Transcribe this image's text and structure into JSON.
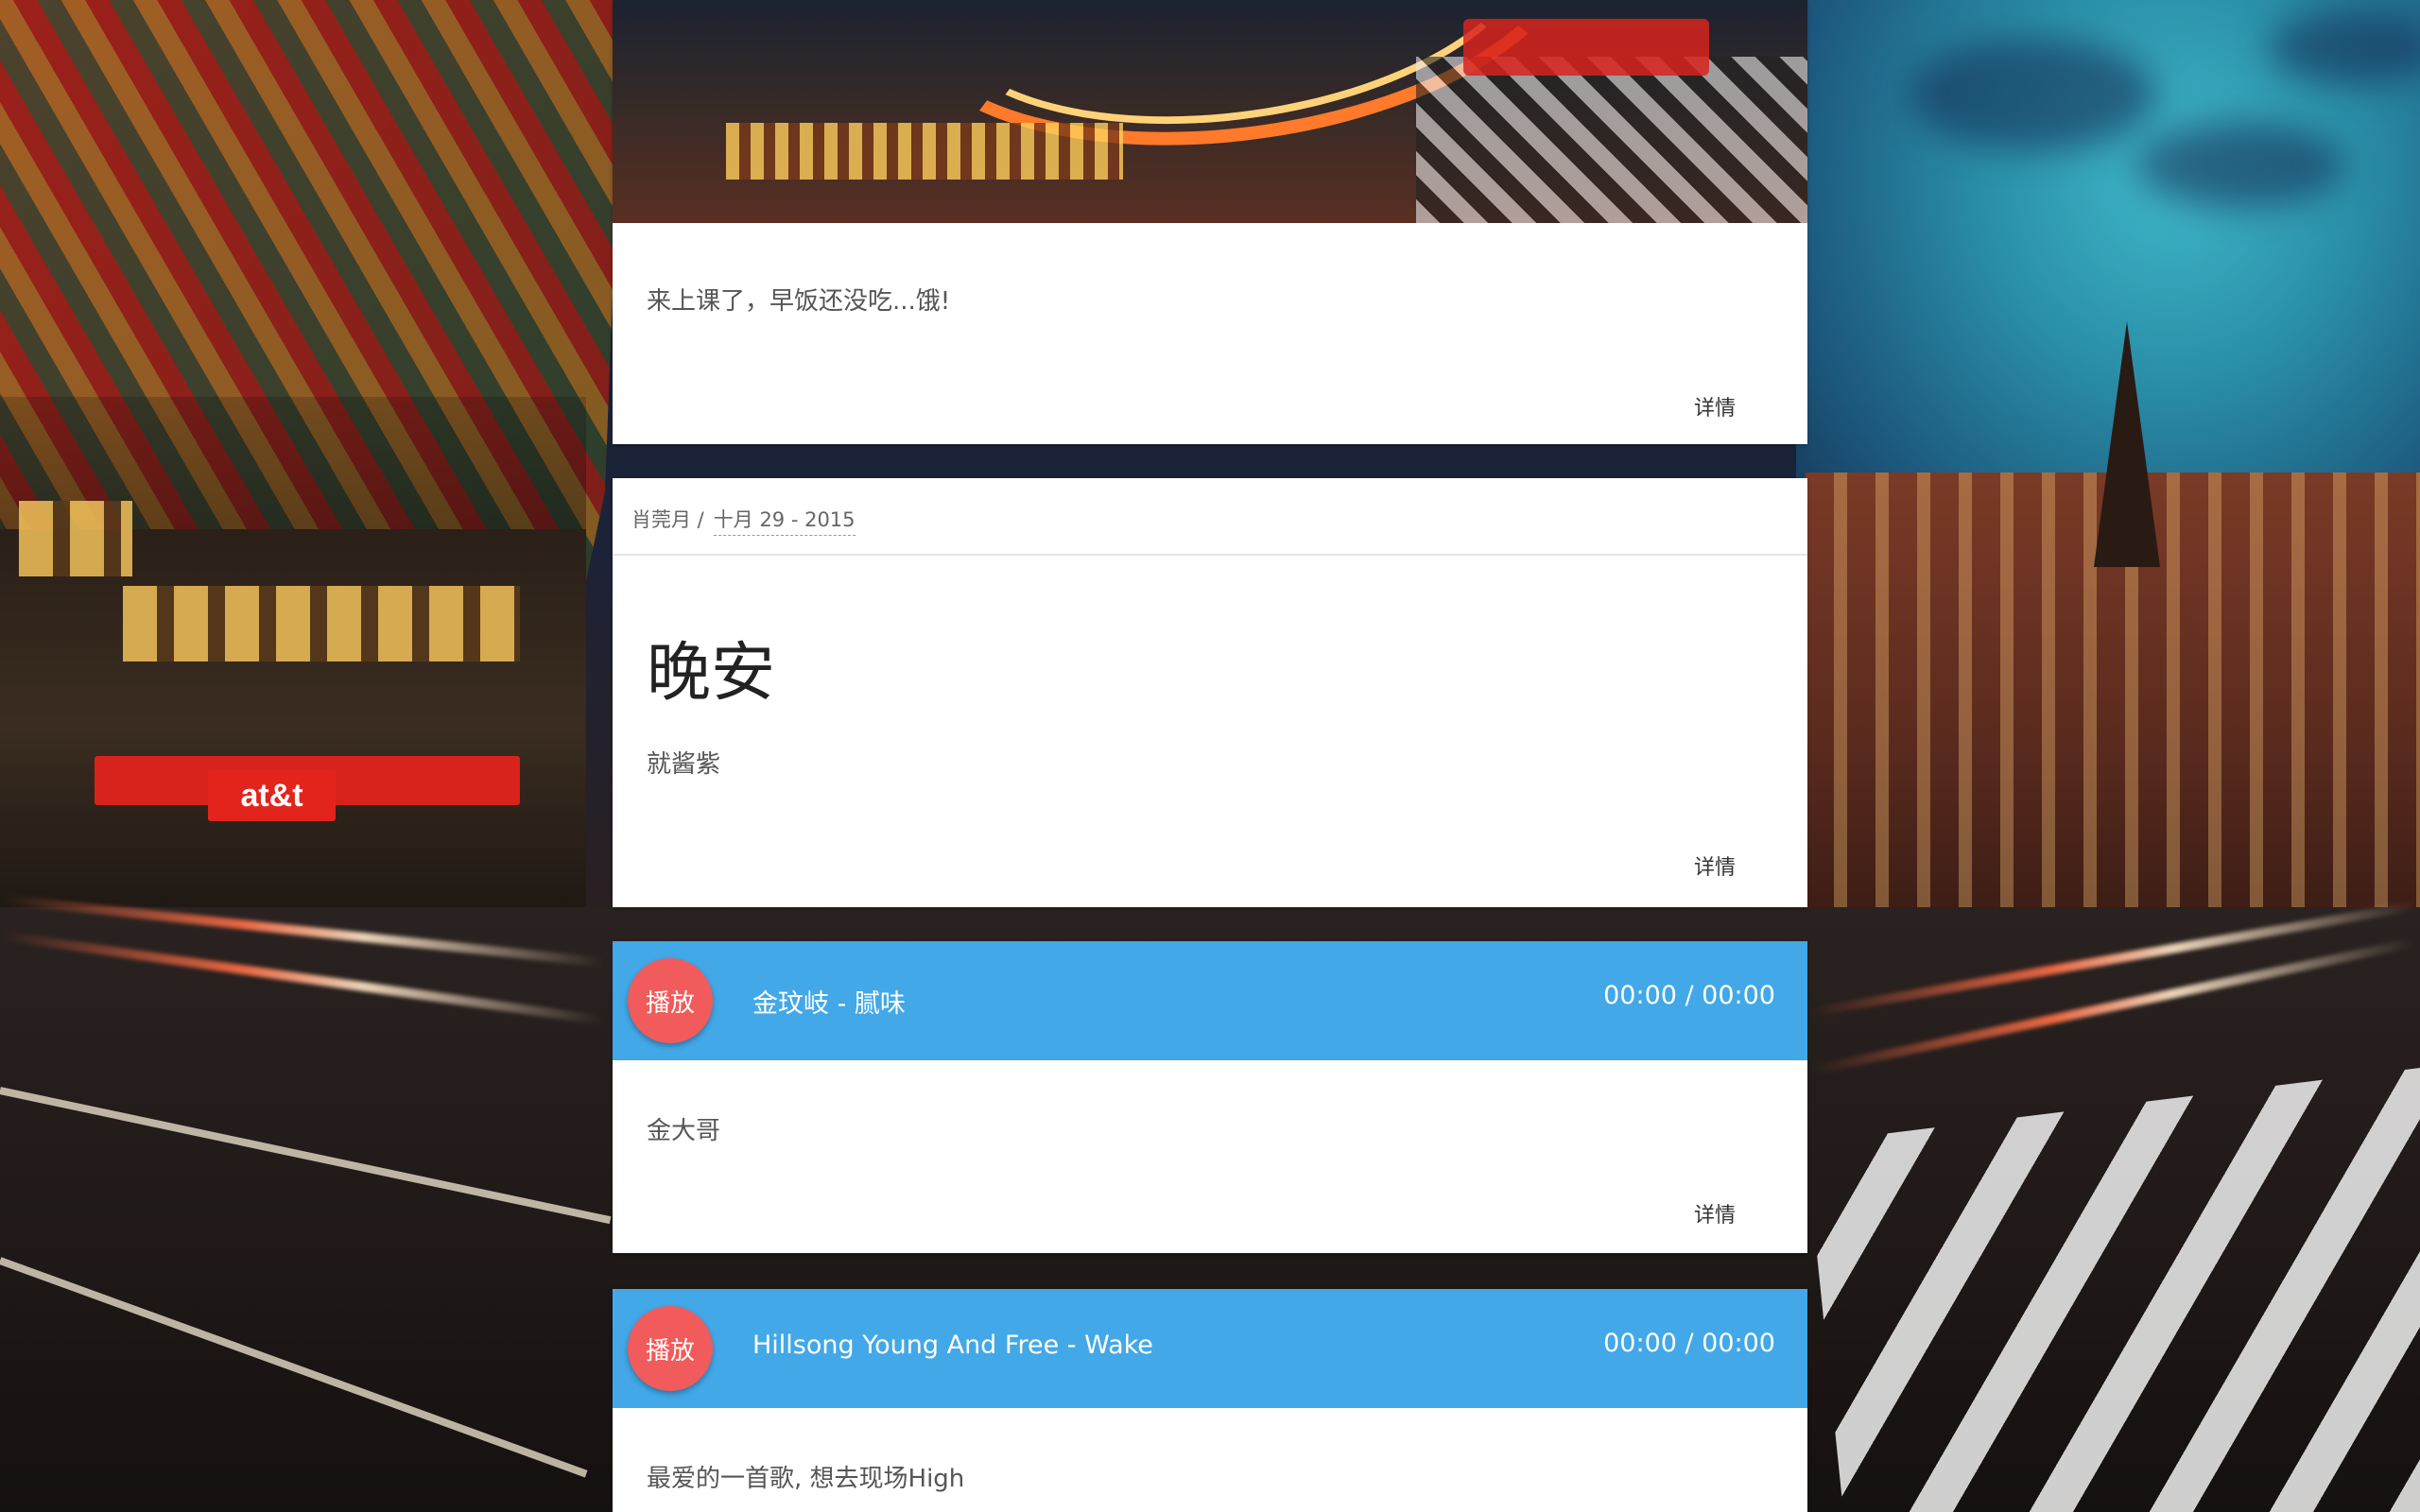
{
  "posts": [
    {
      "caption": "来上课了，早饭还没吃...饿!",
      "detail_label": "详情"
    },
    {
      "author": "肖莞月 /",
      "date": "十月 29 - 2015",
      "title": "晚安",
      "caption": "就酱紫",
      "detail_label": "详情"
    },
    {
      "player": {
        "play_label": "播放",
        "track": "金玟岐 - 腻味",
        "time": "00:00 / 00:00"
      },
      "caption": "金大哥",
      "detail_label": "详情"
    },
    {
      "player": {
        "play_label": "播放",
        "track": "Hillsong Young And Free - Wake",
        "time": "00:00 / 00:00"
      },
      "caption": "最爱的一首歌, 想去现场High"
    }
  ],
  "colors": {
    "player_bar": "#42a8e8",
    "play_button": "#f15b5b",
    "card_bg": "#ffffff"
  }
}
